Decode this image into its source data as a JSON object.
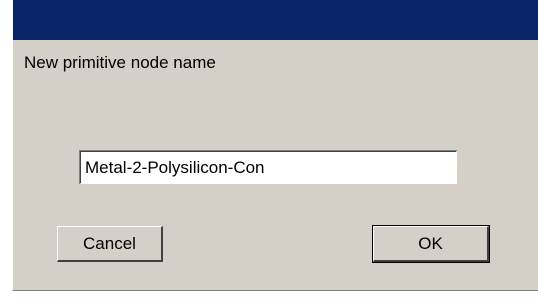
{
  "dialog": {
    "prompt": "New primitive node name",
    "name_value": "Metal-2-Polysilicon-Con",
    "cancel_label": "Cancel",
    "ok_label": "OK"
  },
  "colors": {
    "titlebar": "#0a246a",
    "dialog_face": "#d4d0c8",
    "field_background": "#ffffff"
  }
}
